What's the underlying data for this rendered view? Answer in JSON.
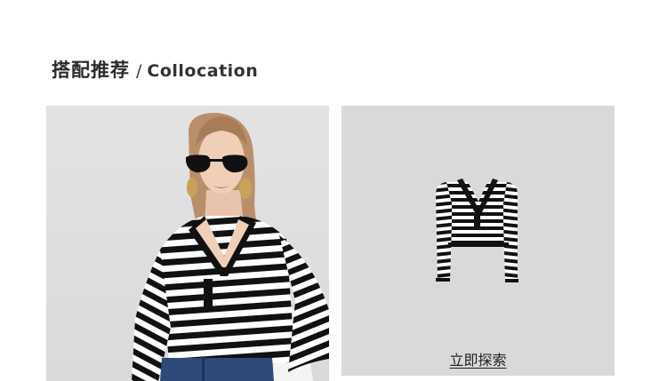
{
  "section": {
    "title_zh": "搭配推荐",
    "separator": "/",
    "title_en": "Collocation"
  },
  "products": {
    "model_photo": {
      "icon": "model-wearing-striped-top-photo"
    },
    "product_photo": {
      "icon": "striped-henley-top-icon"
    },
    "explore_label": "立即探索"
  },
  "colors": {
    "card_bg": "#d9d9d9",
    "stripe_dark": "#111111",
    "stripe_light": "#ffffff"
  }
}
